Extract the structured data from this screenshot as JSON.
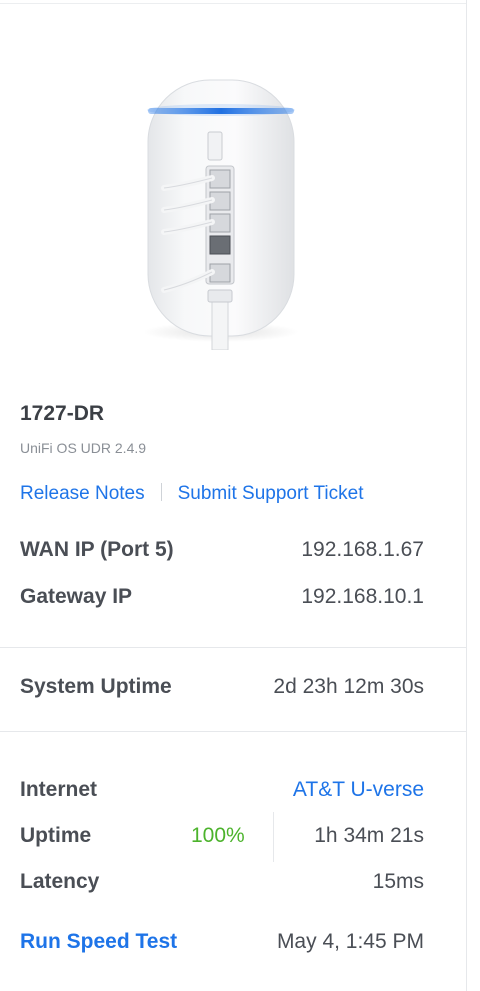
{
  "device": {
    "name": "1727-DR",
    "version": "UniFi OS UDR 2.4.9",
    "image": "unifi-dream-router-illustration",
    "led_color": "#2f7ee8"
  },
  "links": {
    "release_notes": "Release Notes",
    "support_ticket": "Submit Support Ticket"
  },
  "network": {
    "wan_ip_label": "WAN IP (Port 5)",
    "wan_ip_value": "192.168.1.67",
    "gateway_label": "Gateway IP",
    "gateway_value": "192.168.10.1"
  },
  "system": {
    "uptime_label": "System Uptime",
    "uptime_value": "2d 23h 12m 30s"
  },
  "internet": {
    "label": "Internet",
    "isp": "AT&T U-verse",
    "uptime_label": "Uptime",
    "uptime_percent": "100%",
    "uptime_duration": "1h 34m 21s",
    "latency_label": "Latency",
    "latency_value": "15ms",
    "speed_test_label": "Run Speed Test",
    "speed_test_date": "May 4, 1:45 PM"
  },
  "colors": {
    "accent": "#1e74e8",
    "success": "#4cb32c",
    "text": "#4a4e55",
    "muted": "#8a8f96"
  }
}
